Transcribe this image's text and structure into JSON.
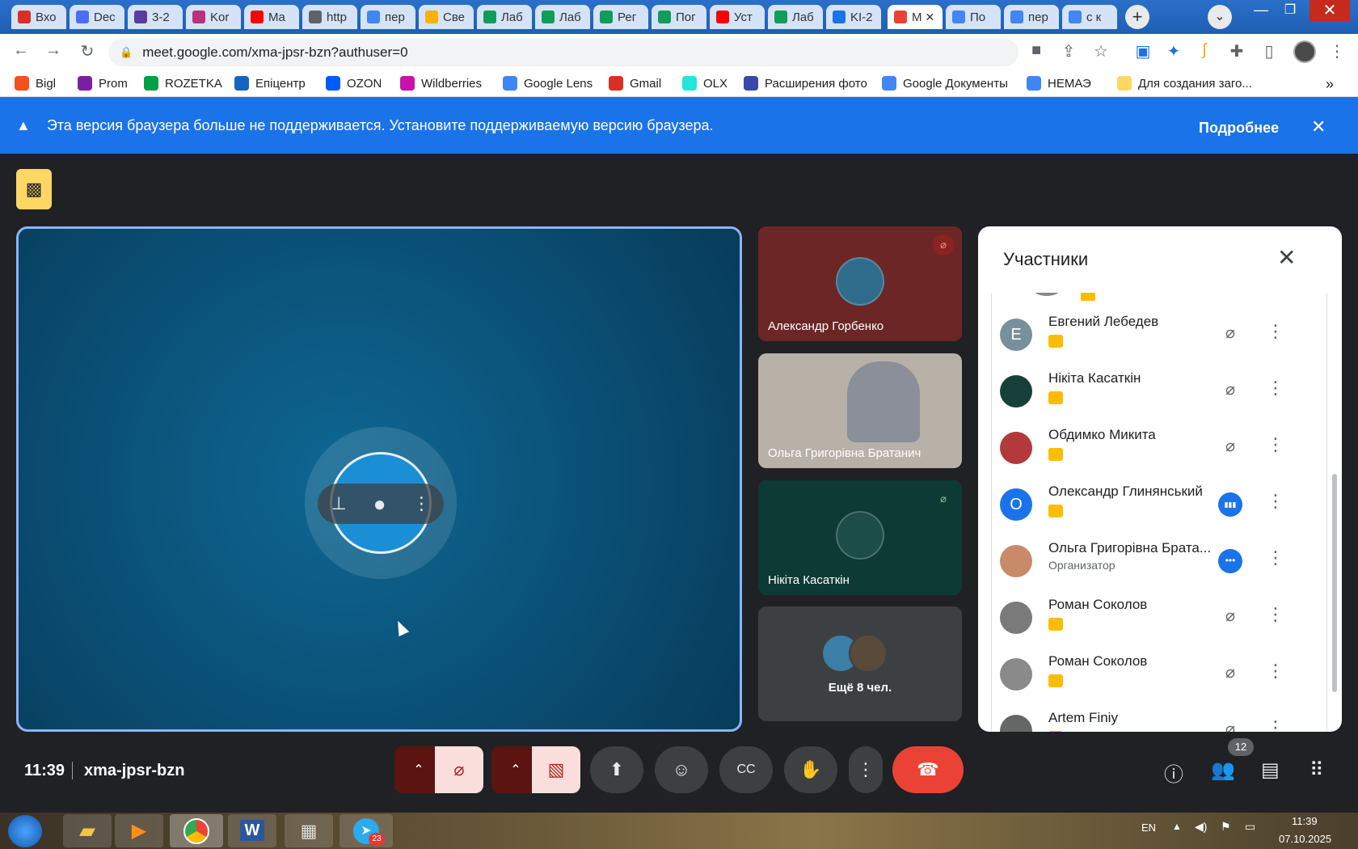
{
  "browser": {
    "tabs": [
      {
        "label": "Вхо",
        "color": "#d93025"
      },
      {
        "label": "Dec",
        "color": "#4c6ef5"
      },
      {
        "label": "3-2",
        "color": "#5b3a9e"
      },
      {
        "label": "Kor",
        "color": "#b83280"
      },
      {
        "label": "Ma",
        "color": "#ff0000"
      },
      {
        "label": "http",
        "color": "#5f6368"
      },
      {
        "label": "пер",
        "color": "#4285f4"
      },
      {
        "label": "Све",
        "color": "#f4b400"
      },
      {
        "label": "Лаб",
        "color": "#0f9d58"
      },
      {
        "label": "Лаб",
        "color": "#0f9d58"
      },
      {
        "label": "Рег",
        "color": "#0f9d58"
      },
      {
        "label": "Пог",
        "color": "#0f9d58"
      },
      {
        "label": "Уст",
        "color": "#ff0000"
      },
      {
        "label": "Лаб",
        "color": "#0f9d58"
      },
      {
        "label": "KI-2",
        "color": "#1a73e8"
      },
      {
        "label": "M",
        "color": "#ea4335"
      },
      {
        "label": "По",
        "color": "#4285f4"
      },
      {
        "label": "пер",
        "color": "#4285f4"
      },
      {
        "label": "с к",
        "color": "#4285f4"
      }
    ],
    "new_tab_label": "+",
    "url": "meet.google.com/xma-jpsr-bzn?authuser=0",
    "bookmarks": [
      {
        "label": "Bigl",
        "color": "#f4511e"
      },
      {
        "label": "Prom",
        "color": "#7b1fa2"
      },
      {
        "label": "ROZETKA",
        "color": "#00a046"
      },
      {
        "label": "Епіцентр",
        "color": "#1565c0"
      },
      {
        "label": "OZON",
        "color": "#005bff"
      },
      {
        "label": "Wildberries",
        "color": "#cb11ab"
      },
      {
        "label": "Google Lens",
        "color": "#4285f4"
      },
      {
        "label": "Gmail",
        "color": "#d93025"
      },
      {
        "label": "OLX",
        "color": "#23e5db"
      },
      {
        "label": "Расширения фото",
        "color": "#3949ab"
      },
      {
        "label": "Google Документы",
        "color": "#4285f4"
      },
      {
        "label": "НЕМАЭ",
        "color": "#4285f4"
      },
      {
        "label": "Для создания заго...",
        "color": "#fdd663"
      }
    ],
    "bookmarks_more": "»"
  },
  "banner": {
    "text": "Эта версия браузера больше не поддерживается. Установите поддерживаемую версию браузера.",
    "link": "Подробнее"
  },
  "meet": {
    "tiles": [
      {
        "name": "Александр Горбенко",
        "bg": "#6d2626",
        "muted": true
      },
      {
        "name": "Ольга Григорівна Братанич",
        "bg": "#b7b1a8",
        "muted": false
      },
      {
        "name": "Нікіта Касаткін",
        "bg": "#0e3a35",
        "muted": true
      }
    ],
    "more_tile": "Ещё 8 чел.",
    "time": "11:39",
    "meeting_code": "xma-jpsr-bzn",
    "participant_count": "12"
  },
  "panel": {
    "title": "Участники",
    "people": [
      {
        "name": "Евгений Лебедев",
        "initial": "Е",
        "avatar_color": "#78909c",
        "sub": "",
        "state": "muted"
      },
      {
        "name": "Нікіта Касаткін",
        "initial": "",
        "avatar_color": "#17403a",
        "sub": "",
        "state": "muted"
      },
      {
        "name": "Обдимко Микита",
        "initial": "",
        "avatar_color": "#b23a3a",
        "sub": "",
        "state": "muted"
      },
      {
        "name": "Олександр Глинянський",
        "initial": "О",
        "avatar_color": "#1a73e8",
        "sub": "",
        "state": "speaking"
      },
      {
        "name": "Ольга Григорівна Брата...",
        "initial": "",
        "avatar_color": "#c98a6a",
        "sub": "Организатор",
        "state": "more"
      },
      {
        "name": "Роман Соколов",
        "initial": "",
        "avatar_color": "#7a7a7a",
        "sub": "",
        "state": "muted"
      },
      {
        "name": "Роман Соколов",
        "initial": "",
        "avatar_color": "#8a8a8a",
        "sub": "",
        "state": "muted"
      },
      {
        "name": "Artem Finiy",
        "initial": "",
        "avatar_color": "#666",
        "sub": "",
        "state": "muted"
      }
    ]
  },
  "taskbar": {
    "lang": "EN",
    "clock_time": "11:39",
    "clock_date": "07.10.2025",
    "telegram_badge": "23"
  }
}
